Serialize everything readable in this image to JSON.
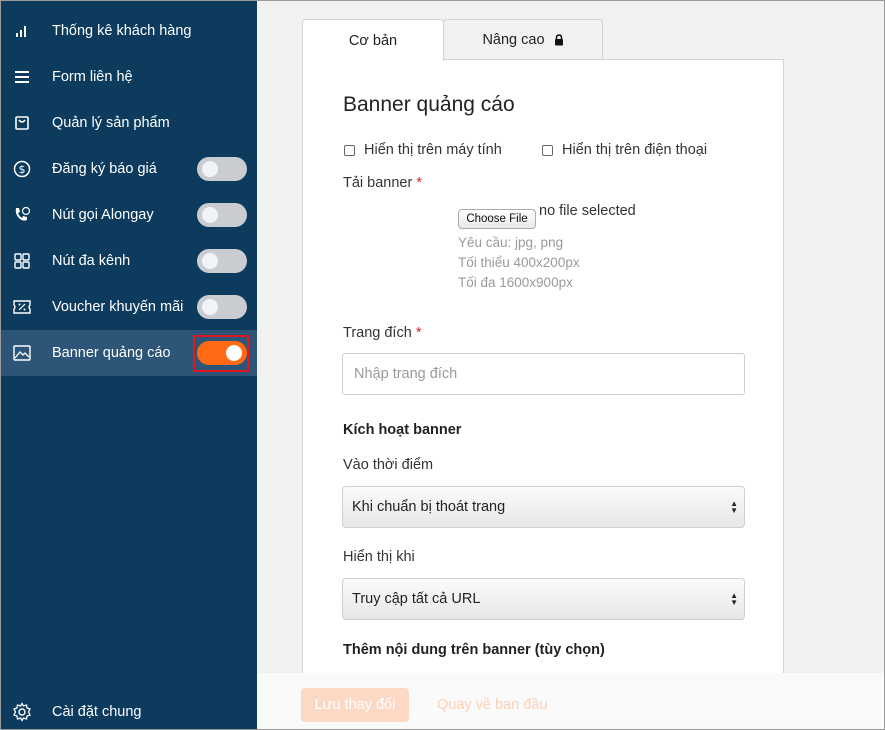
{
  "sidebar": {
    "items": [
      {
        "label": "Thống kê khách hàng",
        "icon": "bar-chart-icon",
        "has_toggle": false
      },
      {
        "label": "Form liên hệ",
        "icon": "form-icon",
        "has_toggle": false
      },
      {
        "label": "Quản lý sản phẩm",
        "icon": "shopping-bag-icon",
        "has_toggle": false
      },
      {
        "label": "Đăng ký báo giá",
        "icon": "dollar-circle-icon",
        "has_toggle": true,
        "toggle_on": false
      },
      {
        "label": "Nút gọi Alongay",
        "icon": "phone-chat-icon",
        "has_toggle": true,
        "toggle_on": false
      },
      {
        "label": "Nút đa kênh",
        "icon": "grid-icon",
        "has_toggle": true,
        "toggle_on": false
      },
      {
        "label": "Voucher khuyến mãi",
        "icon": "voucher-icon",
        "has_toggle": true,
        "toggle_on": false
      },
      {
        "label": "Banner quảng cáo",
        "icon": "image-icon",
        "has_toggle": true,
        "toggle_on": true,
        "active": true
      }
    ],
    "settings": {
      "label": "Cài đặt chung",
      "icon": "gear-icon"
    }
  },
  "tabs": [
    {
      "label": "Cơ bản",
      "active": true
    },
    {
      "label": "Nâng cao",
      "icon": "lock-icon",
      "active": false
    }
  ],
  "form": {
    "title": "Banner quảng cáo",
    "checkbox_desktop": "Hiển thị trên máy tính",
    "checkbox_mobile": "Hiển thị trên điện thoại",
    "upload_label": "Tải banner",
    "required_mark": "*",
    "choose_file": "Choose File",
    "no_file": "no file selected",
    "hints": [
      "Yêu cầu: jpg, png",
      "Tối thiểu 400x200px",
      "Tối đa 1600x900px"
    ],
    "landing_label": "Trang đích",
    "landing_placeholder": "Nhập trang đích",
    "activate_heading": "Kích hoạt banner",
    "timing_label": "Vào thời điểm",
    "timing_value": "Khi chuẩn bị thoát trang",
    "display_label": "Hiển thị khi",
    "display_value": "Truy cập tất cả URL",
    "extra_heading": "Thêm nội dung trên banner (tùy chọn)"
  },
  "footer": {
    "save_label": "Lưu thay đổi",
    "reset_label": "Quay về ban đầu"
  },
  "colors": {
    "sidebar_bg": "#0d3b5e",
    "sidebar_active": "#2c5577",
    "toggle_on": "#ff6a13",
    "highlight": "#e0171f",
    "required": "#d9262c"
  }
}
